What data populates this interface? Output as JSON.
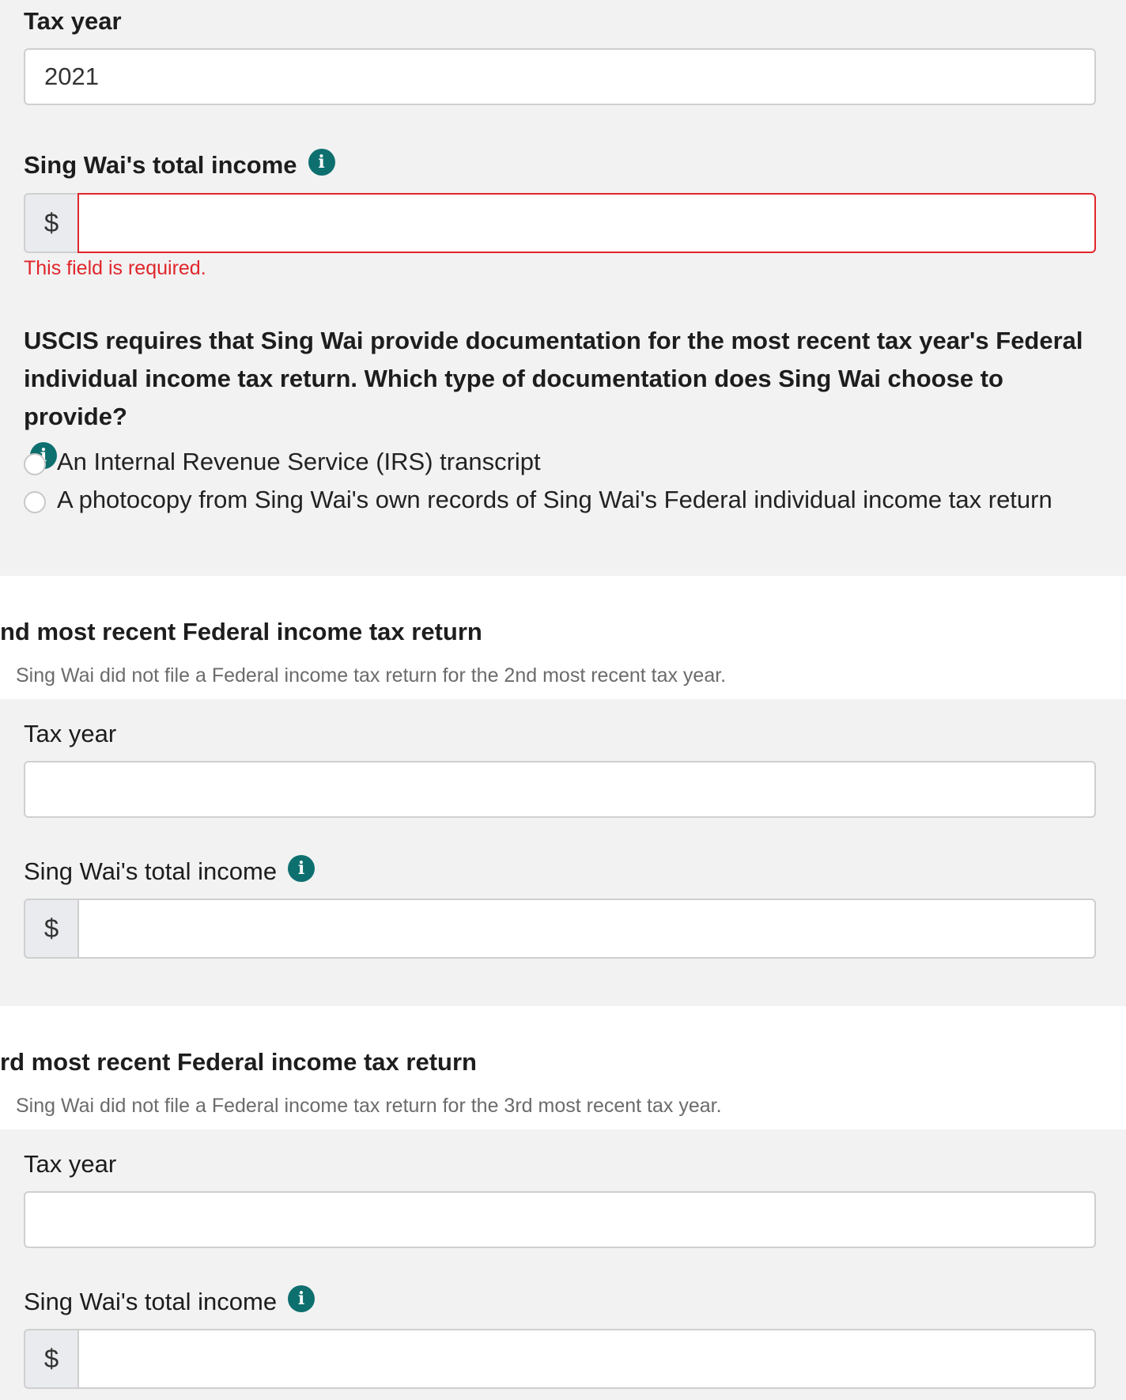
{
  "section1": {
    "tax_year_label": "Tax year",
    "tax_year_value": "2021",
    "income_label": "Sing Wai's total income",
    "currency_symbol": "$",
    "income_value": "",
    "error_message": "This field is required.",
    "question": "USCIS requires that Sing Wai provide documentation for the most recent tax year's Federal individual income tax return. Which type of documentation does Sing Wai choose to provide?",
    "options": [
      "An Internal Revenue Service (IRS) transcript",
      "A photocopy from Sing Wai's own records of Sing Wai's Federal individual income tax return"
    ]
  },
  "section2": {
    "title": "nd most recent Federal income tax return",
    "note": "Sing Wai did not file a Federal income tax return for the 2nd most recent tax year.",
    "tax_year_label": "Tax year",
    "tax_year_value": "",
    "income_label": "Sing Wai's total income",
    "currency_symbol": "$",
    "income_value": ""
  },
  "section3": {
    "title": "rd most recent Federal income tax return",
    "note": "Sing Wai did not file a Federal income tax return for the 3rd most recent tax year.",
    "tax_year_label": "Tax year",
    "tax_year_value": "",
    "income_label": "Sing Wai's total income",
    "currency_symbol": "$",
    "income_value": ""
  },
  "icons": {
    "info": "info-icon"
  },
  "colors": {
    "accent": "#0e6f6f",
    "error": "#e0262b",
    "panel": "#f2f2f2"
  }
}
